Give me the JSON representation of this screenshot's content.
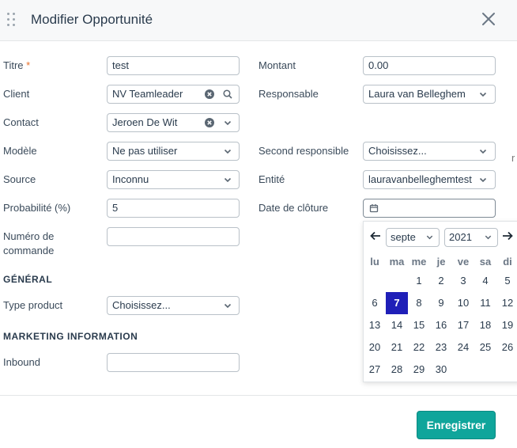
{
  "modal": {
    "title": "Modifier Opportunité"
  },
  "form": {
    "titre": {
      "label": "Titre",
      "required": "*",
      "value": "test"
    },
    "montant": {
      "label": "Montant",
      "value": "0.00"
    },
    "client": {
      "label": "Client",
      "value": "NV Teamleader"
    },
    "responsable": {
      "label": "Responsable",
      "value": "Laura van Belleghem"
    },
    "contact": {
      "label": "Contact",
      "value": "Jeroen De Wit"
    },
    "modele": {
      "label": "Modèle",
      "value": "Ne pas utiliser"
    },
    "second_responsable": {
      "label": "Second responsible",
      "value": "Choisissez..."
    },
    "source": {
      "label": "Source",
      "value": "Inconnu"
    },
    "entite": {
      "label": "Entité",
      "value": "lauravanbelleghemtest"
    },
    "probabilite": {
      "label": "Probabilité (%)",
      "value": "5"
    },
    "date_cloture": {
      "label": "Date de clôture",
      "value": ""
    },
    "numero_commande": {
      "label_line1": "Numéro de",
      "label_line2": "commande",
      "value": ""
    }
  },
  "sections": {
    "general": {
      "title": "GÉNÉRAL",
      "type_product": {
        "label": "Type product",
        "value": "Choisissez..."
      }
    },
    "marketing": {
      "title": "MARKETING INFORMATION",
      "inbound": {
        "label": "Inbound",
        "value": ""
      }
    }
  },
  "calendar": {
    "month": "septe",
    "year": "2021",
    "weekdays": [
      "lu",
      "ma",
      "me",
      "je",
      "ve",
      "sa",
      "di"
    ],
    "weeks": [
      [
        "",
        "",
        "1",
        "2",
        "3",
        "4",
        "5"
      ],
      [
        "6",
        "7",
        "8",
        "9",
        "10",
        "11",
        "12"
      ],
      [
        "13",
        "14",
        "15",
        "16",
        "17",
        "18",
        "19"
      ],
      [
        "20",
        "21",
        "22",
        "23",
        "24",
        "25",
        "26"
      ],
      [
        "27",
        "28",
        "29",
        "30",
        "",
        "",
        ""
      ]
    ],
    "selected_day": "7"
  },
  "footer": {
    "save_label": "Enregistrer"
  },
  "side_glyph": "r",
  "colors": {
    "primary": "#0fa59b",
    "selected_day": "#1f1fb8",
    "required": "#e8702a"
  },
  "icons": [
    "drag-handle-icon",
    "close-icon",
    "clear-icon",
    "search-icon",
    "chevron-down-icon",
    "calendar-icon",
    "arrow-left-icon",
    "arrow-right-icon"
  ]
}
